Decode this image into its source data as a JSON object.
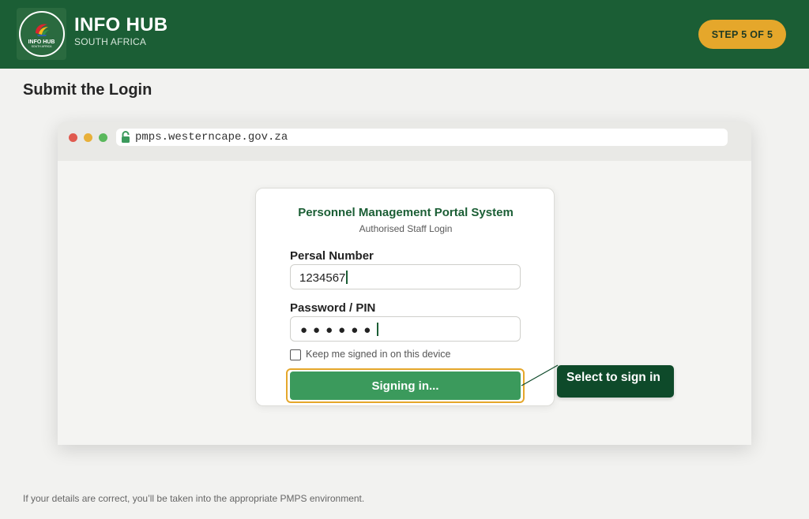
{
  "header": {
    "logo_text": "INFO HUB",
    "logo_subtext": "SOUTH AFRICA",
    "brand_title": "INFO HUB",
    "brand_subtitle": "SOUTH AFRICA",
    "step_badge": "STEP 5 OF 5",
    "colors": {
      "header_bg": "#1b5e35",
      "badge_bg": "#e5a72b"
    }
  },
  "page": {
    "heading": "Submit the Login",
    "footer_note": "If your details are correct, you’ll be taken into the appropriate PMPS environment."
  },
  "browser": {
    "url": "pmps.westerncape.gov.za",
    "lock_icon": "lock-icon"
  },
  "login_card": {
    "title": "Personnel Management Portal System",
    "subtitle": "Authorised Staff Login",
    "persal_label": "Persal Number",
    "persal_value": "1234567",
    "password_label": "Password / PIN",
    "password_mask": "●●●●●●",
    "remember_label": "Keep me signed in on this device",
    "remember_checked": false,
    "submit_label": "Signing in...",
    "colors": {
      "title": "#1b5e35",
      "button": "#3b9a5c",
      "highlight": "#e5a72b"
    }
  },
  "callout": {
    "text": "Select to sign in",
    "color": "#0e4a2a"
  }
}
